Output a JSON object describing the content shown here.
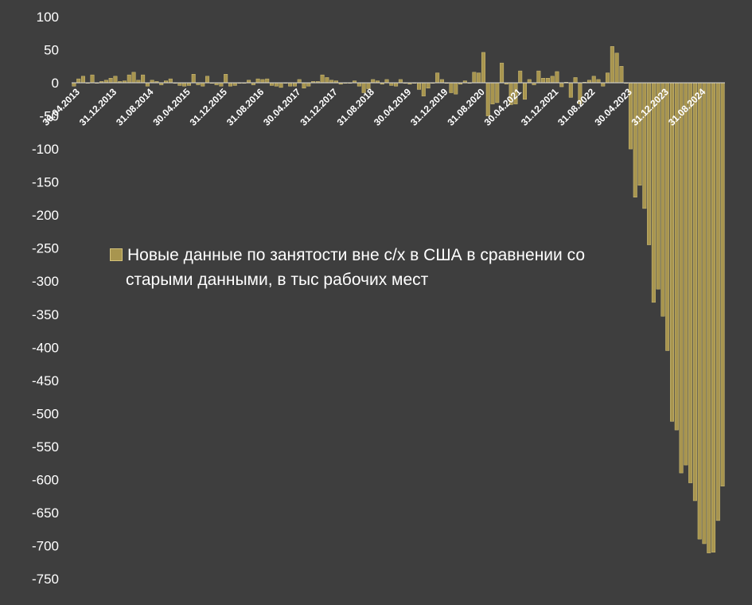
{
  "chart_data": {
    "type": "bar",
    "ylim": [
      -750,
      100
    ],
    "yticks": [
      100,
      50,
      0,
      -50,
      -100,
      -150,
      -200,
      -250,
      -300,
      -350,
      -400,
      -450,
      -500,
      -550,
      -600,
      -650,
      -700,
      -750
    ],
    "ytick_labels": [
      "100",
      "50",
      "0",
      "-50",
      "-100",
      "-150",
      "-200",
      "-250",
      "-300",
      "-350",
      "-400",
      "-450",
      "-500",
      "-550",
      "-600",
      "-650",
      "-700",
      "-750"
    ],
    "x_tick_labels": [
      {
        "index": 0,
        "label": "30.04.2013"
      },
      {
        "index": 8,
        "label": "31.12.2013"
      },
      {
        "index": 16,
        "label": "31.08.2014"
      },
      {
        "index": 24,
        "label": "30.04.2015"
      },
      {
        "index": 32,
        "label": "31.12.2015"
      },
      {
        "index": 40,
        "label": "31.08.2016"
      },
      {
        "index": 48,
        "label": "30.04.2017"
      },
      {
        "index": 56,
        "label": "31.12.2017"
      },
      {
        "index": 64,
        "label": "31.08.2018"
      },
      {
        "index": 72,
        "label": "30.04.2019"
      },
      {
        "index": 80,
        "label": "31.12.2019"
      },
      {
        "index": 88,
        "label": "31.08.2020"
      },
      {
        "index": 96,
        "label": "30.04.2021"
      },
      {
        "index": 104,
        "label": "31.12.2021"
      },
      {
        "index": 112,
        "label": "31.08.2022"
      },
      {
        "index": 120,
        "label": "30.04.2023"
      },
      {
        "index": 128,
        "label": "31.12.2023"
      },
      {
        "index": 136,
        "label": "31.08.2024"
      }
    ],
    "legend": {
      "label": "Новые данные по занятости вне с/х в США в сравнении со старыми данными, в тыс рабочих мест",
      "line1": "Новые данные по занятости вне с/х в США в сравнении со",
      "line2": "старыми данными, в тыс рабочих мест",
      "position": "center-left"
    },
    "grid": false,
    "colors": {
      "bar_fill": "#a8954f",
      "bar_edge": "#d3c27a",
      "background": "#3e3e3e",
      "text": "#ffffff"
    },
    "values": [
      -5,
      6,
      10,
      0,
      12,
      0,
      2,
      4,
      7,
      10,
      2,
      3,
      12,
      16,
      4,
      12,
      -5,
      4,
      2,
      -3,
      3,
      6,
      0,
      -4,
      -5,
      -4,
      13,
      -3,
      -5,
      10,
      0,
      -3,
      -5,
      13,
      -5,
      -4,
      0,
      0,
      4,
      -3,
      6,
      5,
      6,
      -4,
      -5,
      -7,
      0,
      -5,
      -5,
      5,
      -8,
      -5,
      2,
      2,
      12,
      8,
      4,
      3,
      -2,
      0,
      0,
      3,
      -5,
      -15,
      -9,
      5,
      3,
      -2,
      5,
      -4,
      -5,
      5,
      0,
      -2,
      0,
      -10,
      -20,
      -8,
      0,
      15,
      5,
      0,
      -15,
      -17,
      -2,
      3,
      0,
      16,
      15,
      46,
      -50,
      -32,
      -30,
      30,
      -2,
      -33,
      -32,
      18,
      -25,
      5,
      -3,
      18,
      7,
      7,
      10,
      17,
      -6,
      1,
      -22,
      8,
      -32,
      1,
      4,
      10,
      5,
      -5,
      15,
      55,
      45,
      25,
      0,
      -100,
      -173,
      -155,
      -190,
      -245,
      -332,
      -312,
      -353,
      -405,
      -512,
      -525,
      -590,
      -578,
      -605,
      -632,
      -690,
      -697,
      -711,
      -710,
      -662,
      -610
    ]
  }
}
